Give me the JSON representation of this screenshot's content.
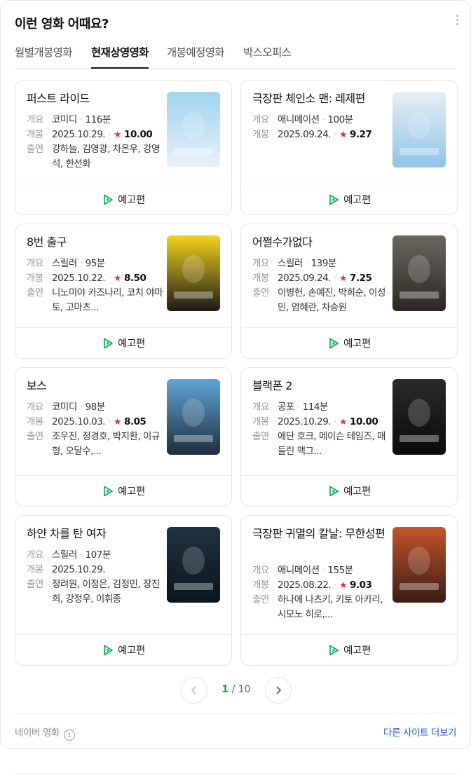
{
  "header": {
    "title": "이런 영화 어때요?"
  },
  "tabs": [
    {
      "label": "월별개봉영화"
    },
    {
      "label": "현재상영영화"
    },
    {
      "label": "개봉예정영화"
    },
    {
      "label": "박스오피스"
    }
  ],
  "labels": {
    "overview": "개요",
    "release": "개봉",
    "cast": "출연",
    "trailer": "예고편",
    "star": "★"
  },
  "movies": [
    {
      "title": "퍼스트 라이드",
      "genre": "코미디",
      "runtime": "116분",
      "release": "2025.10.29.",
      "rating": "10.00",
      "cast": "강하늘, 김영광, 차은우, 강영석, 한선화",
      "poster_colors": [
        "#9fd3f0",
        "#e8f1f8"
      ]
    },
    {
      "title": "극장판 체인소 맨: 레제편",
      "genre": "애니메이션",
      "runtime": "100분",
      "release": "2025.09.24.",
      "rating": "9.27",
      "cast": "",
      "poster_colors": [
        "#e9eef3",
        "#8ec3e8"
      ]
    },
    {
      "title": "8번 출구",
      "genre": "스릴러",
      "runtime": "95분",
      "release": "2025.10.22.",
      "rating": "8.50",
      "cast": "니노미야 카즈나리, 코치 야마토, 고마츠...",
      "poster_colors": [
        "#f5d21b",
        "#1a1a1a"
      ]
    },
    {
      "title": "어쩔수가없다",
      "genre": "스릴러",
      "runtime": "139분",
      "release": "2025.09.24.",
      "rating": "7.25",
      "cast": "이병헌, 손예진, 박희순, 이성민, 염혜란, 차승원",
      "poster_colors": [
        "#6b6860",
        "#2a2622"
      ]
    },
    {
      "title": "보스",
      "genre": "코미디",
      "runtime": "98분",
      "release": "2025.10.03.",
      "rating": "8.05",
      "cast": "조우진, 정경호, 박지환, 이규형, 오달수,...",
      "poster_colors": [
        "#5fa6d8",
        "#1e2c3c"
      ]
    },
    {
      "title": "블랙폰 2",
      "genre": "공포",
      "runtime": "114분",
      "release": "2025.10.29.",
      "rating": "10.00",
      "cast": "에단 호크, 메이슨 테임즈, 매들린 맥그...",
      "poster_colors": [
        "#2a2a2a",
        "#0a0a0a"
      ]
    },
    {
      "title": "하얀 차를 탄 여자",
      "genre": "스릴러",
      "runtime": "107분",
      "release": "2025.10.29.",
      "rating": "",
      "cast": "정려원, 이정은, 김정민, 장진희, 강정우, 이휘종",
      "poster_colors": [
        "#1e3240",
        "#0c141c"
      ]
    },
    {
      "title": "극장판 귀멸의 칼날: 무한성편",
      "genre": "애니메이션",
      "runtime": "155분",
      "release": "2025.08.22.",
      "rating": "9.03",
      "cast": "하나에 나츠키, 키토 아카리, 시모노 히로,...",
      "poster_colors": [
        "#c4542a",
        "#3a1c14"
      ]
    }
  ],
  "pagination": {
    "current": "1",
    "separator": "/",
    "total": "10"
  },
  "footer": {
    "source": "네이버 영화",
    "info_icon": "i",
    "more_link": "다른 사이트 더보기"
  }
}
